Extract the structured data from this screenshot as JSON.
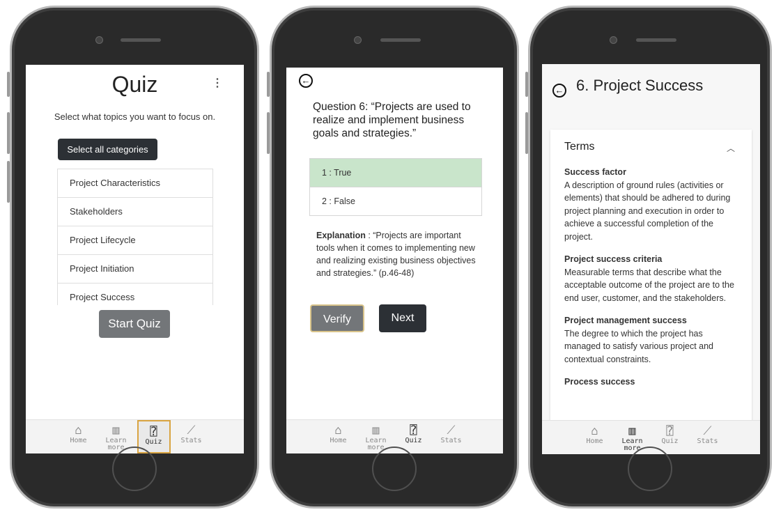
{
  "nav": {
    "home": "Home",
    "learn_line1": "Learn",
    "learn_line2": "more",
    "quiz": "Quiz",
    "stats": "Stats",
    "home_icon": "home-icon",
    "learn_icon": "book-icon",
    "quiz_icon": "quiz-icon",
    "stats_icon": "chart-icon"
  },
  "screen1": {
    "title": "Quiz",
    "subtitle": "Select what topics you want to focus on.",
    "select_all": "Select all categories",
    "categories": [
      "Project Characteristics",
      "Stakeholders",
      "Project Lifecycle",
      "Project Initiation",
      "Project Success"
    ],
    "start_button": "Start Quiz",
    "menu_icon": "more-vertical-icon"
  },
  "screen2": {
    "question": "Question 6: “Projects are used to realize and implement business goals and strategies.”",
    "answers": [
      "1 : True",
      "2 : False"
    ],
    "explanation_label": "Explanation",
    "explanation_text": " : “Projects are important tools when it comes to implementing new and realizing existing business objectives and strategies.” (p.46-48)",
    "verify_button": "Verify",
    "next_button": "Next",
    "correct_color": "#c9e5cb"
  },
  "screen3": {
    "title": "6. Project Success",
    "section": "Terms",
    "terms": [
      {
        "term": "Success factor",
        "definition": "A description of ground rules (activities or elements) that should be adhered to during project planning and execution in order to achieve a successful completion of the project."
      },
      {
        "term": "Project success criteria",
        "definition": "Measurable terms that describe what the acceptable outcome of the project are to the end user, customer, and the stakeholders."
      },
      {
        "term": "Project management success",
        "definition": "The degree to which the project has managed to satisfy various project and contextual constraints."
      },
      {
        "term": "Process success",
        "definition": ""
      }
    ]
  }
}
